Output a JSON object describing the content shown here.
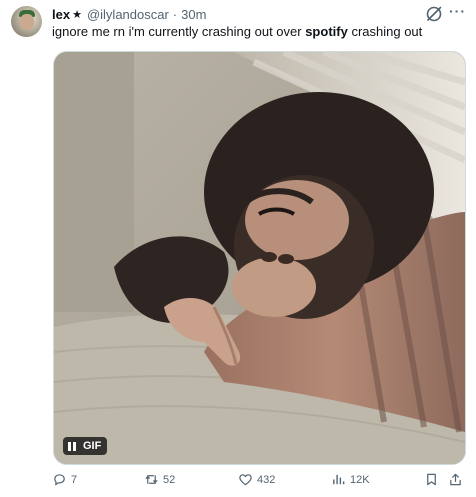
{
  "author": {
    "name": "lex",
    "badge": "★",
    "handle": "@ilylandoscar",
    "separator": "·",
    "time": "30m"
  },
  "tweet": {
    "text_before": "ignore me rn i'm currently crashing out over ",
    "text_bold": "spotify",
    "text_after": " crashing out"
  },
  "media": {
    "badge_label": "GIF"
  },
  "actions": {
    "replies": "7",
    "retweets": "52",
    "likes": "432",
    "views": "12K"
  },
  "colors": {
    "text_primary": "#0f1419",
    "text_secondary": "#536471",
    "border": "#cfd9de"
  },
  "icons": [
    "grok-icon",
    "more-icon",
    "pause-icon",
    "reply-icon",
    "retweet-icon",
    "like-icon",
    "views-icon",
    "bookmark-icon",
    "share-icon"
  ]
}
